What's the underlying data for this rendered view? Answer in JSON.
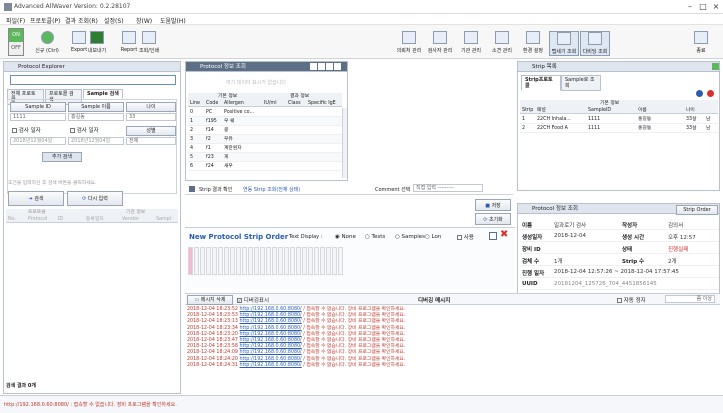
{
  "app": {
    "title": "Advanced AllWaver Version: 0.2.28107"
  },
  "menu": [
    "파일(F)",
    "프로토콜(P)",
    "결과 조회(R)",
    "설정(S)",
    "창(W)",
    "도움말(H)"
  ],
  "toolbar": {
    "toggle_on": "ON",
    "toggle_off": "OFF",
    "left": [
      "신규 (Ctrl)",
      "Export",
      "내보내기",
      "Report",
      "조회/인쇄"
    ],
    "right": [
      "의뢰처 관리",
      "검사자 관리",
      "기관 관리",
      "소견 관리",
      "환경 설정",
      "탭세기 조회",
      "다비딩 조회"
    ],
    "end": "종료"
  },
  "explorer": {
    "title": "Protocol Explorer",
    "search_placeholder": "",
    "tabs": [
      "전체 프로토콜",
      "프로토콜 검색",
      "Sample 검색"
    ],
    "fields": {
      "sample_id_label": "Sample ID",
      "sample_name_label": "Sample 이름",
      "age_label": "나이",
      "sample_id": "1111",
      "sample_name": "홍길동",
      "age": "33",
      "chk_date1": "검사 일자",
      "chk_date2": "검사 일자",
      "date1": "2018년12월04일",
      "date2": "2018년12월04일",
      "gender_label": "성별",
      "gender": "전체",
      "add_btn": "추가 검색"
    },
    "hint": "조건을 입력하신 후 검색 버튼을 클릭하세요.",
    "search_btn": "검색",
    "reset_btn": "다시 입력",
    "grid_cols": [
      "프로토콜",
      "기관 정보"
    ],
    "grid_sub": [
      "No.",
      "Protocol",
      "ID",
      "등록일자",
      "Vendor",
      "Sampl"
    ],
    "footer": "검색 결과 0개"
  },
  "protocol_info": {
    "title": "Protocol 정보 조회",
    "placeholder": "여기 데이터 표시가 없습니다",
    "group1": "기본 정보",
    "group2": "결과 정보",
    "cols": [
      "Line",
      "Code",
      "Allergen",
      "IU/ml",
      "Class",
      "Specific IgE"
    ],
    "rows": [
      [
        "0",
        "PC",
        "Positive co..."
      ],
      [
        "1",
        "f195",
        "우 쉐"
      ],
      [
        "2",
        "f14",
        "콩"
      ],
      [
        "3",
        "f2",
        "우유"
      ],
      [
        "4",
        "f1",
        "계란흰자"
      ],
      [
        "5",
        "f23",
        "게"
      ],
      [
        "6",
        "f24",
        "새우"
      ]
    ]
  },
  "strip_list": {
    "title": "Strip 목록",
    "tabs": [
      "Strip프로토콜",
      "Sample로 조회"
    ],
    "group": "기본 정보",
    "cols": [
      "Strip",
      "패널",
      "SampleID",
      "이름",
      "나이",
      ""
    ],
    "rows": [
      [
        "1",
        "22CH Inhala...",
        "1111",
        "홍길동",
        "33살",
        "남"
      ],
      [
        "2",
        "22CH Food A",
        "1111",
        "홍길동",
        "33살",
        "남"
      ]
    ]
  },
  "strip_result": {
    "label": "Strip 결과 확인",
    "link": "연동 Strip 조회(전체 상태)",
    "comment_label": "Comment 선택",
    "comment_value": "직접 입력 ---------",
    "save": "저장",
    "reset": "초기화"
  },
  "new_order": {
    "title": "New Protocol Strip Order",
    "display_label": "Text Display :",
    "options": [
      "None",
      "Tests",
      "Samples",
      "Lon"
    ],
    "print": "사용",
    "strip_count": 26
  },
  "protocol_detail": {
    "title": "Protocol 정보 조회",
    "strip_order_btn": "Strip Order",
    "rows": [
      {
        "l": "이름",
        "v": "일과로기 검사",
        "l2": "작성자",
        "v2": "김의서"
      },
      {
        "l": "생성일자",
        "v": "2018-12-04",
        "l2": "생성 시간",
        "v2": "오후 12:57"
      },
      {
        "l": "장비 ID",
        "v": "",
        "l2": "상태",
        "v2": "진행실패"
      },
      {
        "l": "검체 수",
        "v": "1개",
        "l2": "Strip 수",
        "v2": "2개"
      },
      {
        "l": "진행 일자",
        "v": "2018-12-04 12:57:26 ~ 2018-12-04 17:57:45",
        "l2": "",
        "v2": ""
      },
      {
        "l": "UUID",
        "v": "20181204_125726_704_4451856145",
        "l2": "",
        "v2": ""
      }
    ]
  },
  "log": {
    "btn_clear": "메시지 삭제",
    "chk_label": "디버깅표시",
    "title": "디버깅 메시지",
    "chk2": "자동 정지",
    "right_box": "쯤 이상",
    "lines": [
      [
        "2018-12-04 18:23:52",
        "http://192.168.0.60:8080/",
        "/ 접속할 수 없습니다. 장비 프로그램을 확인하세요."
      ],
      [
        "2018-12-04 18:23:53",
        "http://192.168.0.60:8080/",
        "/ 접속할 수 없습니다. 장비 프로그램을 확인하세요."
      ],
      [
        "2018-12-04 18:23:13",
        "http://192.168.0.60:8080/",
        "/ 접속할 수 없습니다. 장비 프로그램을 확인하세요."
      ],
      [
        "2018-12-04 18:23:34",
        "http://192.168.0.60:8080/",
        "/ 접속할 수 없습니다. 장비 프로그램을 확인하세요."
      ],
      [
        "2018-12-04 18:23:20",
        "http://192.168.0.60:8080/",
        "/ 접속할 수 없습니다. 장비 프로그램을 확인하세요."
      ],
      [
        "2018-12-04 18:23:47",
        "http://192.168.0.60:8080/",
        "/ 접속할 수 없습니다. 장비 프로그램을 확인하세요."
      ],
      [
        "2018-12-04 18:23:58",
        "http://192.168.0.60:8080/",
        "/ 접속할 수 없습니다. 장비 프로그램을 확인하세요."
      ],
      [
        "2018-12-04 18:24:09",
        "http://192.168.0.60:8080/",
        "/ 접속할 수 없습니다. 장비 프로그램을 확인하세요."
      ],
      [
        "2018-12-04 18:24:20",
        "http://192.168.0.60:8080/",
        "/ 접속할 수 없습니다. 장비 프로그램을 확인하세요."
      ],
      [
        "2018-12-04 18:24:31",
        "http://192.168.0.60:8080/",
        "/ 접속할 수 없습니다. 장비 프로그램을 확인하세요."
      ]
    ]
  },
  "status": {
    "text": "http://192.168.0.60:8080/ : 접속할 수 없습니다. 장비 프로그램을 확인하세요."
  },
  "colors": {
    "accent": "#2a5db0",
    "error": "#c0392b",
    "header": "#5d6f87"
  }
}
